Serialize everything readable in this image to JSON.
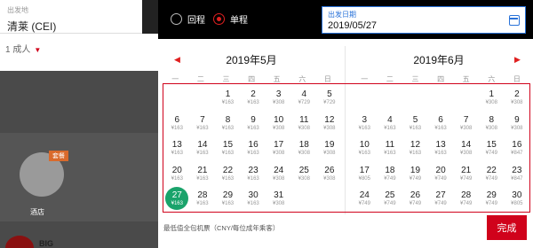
{
  "background": {
    "origin_label": "出发地",
    "origin_value": "清莱 (CEI)",
    "passengers": "1 成人",
    "badge": "套餐",
    "hotel_label": "酒店",
    "logo_text": "BIG"
  },
  "header": {
    "return_label": "回程",
    "oneway_label": "单程",
    "depart_label": "出发日期",
    "depart_value": "2019/05/27"
  },
  "months": [
    {
      "title": "2019年5月",
      "weekdays": [
        "一",
        "二",
        "三",
        "四",
        "五",
        "六",
        "日"
      ],
      "offset": 2,
      "days": [
        {
          "d": "1",
          "p": "¥163"
        },
        {
          "d": "2",
          "p": "¥163"
        },
        {
          "d": "3",
          "p": "¥308"
        },
        {
          "d": "4",
          "p": "¥729"
        },
        {
          "d": "5",
          "p": "¥729"
        },
        {
          "d": "6",
          "p": "¥163"
        },
        {
          "d": "7",
          "p": "¥163"
        },
        {
          "d": "8",
          "p": "¥163"
        },
        {
          "d": "9",
          "p": "¥163"
        },
        {
          "d": "10",
          "p": "¥308"
        },
        {
          "d": "11",
          "p": "¥308"
        },
        {
          "d": "12",
          "p": "¥308"
        },
        {
          "d": "13",
          "p": "¥163"
        },
        {
          "d": "14",
          "p": "¥163"
        },
        {
          "d": "15",
          "p": "¥163"
        },
        {
          "d": "16",
          "p": "¥163"
        },
        {
          "d": "17",
          "p": "¥308"
        },
        {
          "d": "18",
          "p": "¥308"
        },
        {
          "d": "19",
          "p": "¥308"
        },
        {
          "d": "20",
          "p": "¥163"
        },
        {
          "d": "21",
          "p": "¥163"
        },
        {
          "d": "22",
          "p": "¥163"
        },
        {
          "d": "23",
          "p": "¥163"
        },
        {
          "d": "24",
          "p": "¥308"
        },
        {
          "d": "25",
          "p": "¥308"
        },
        {
          "d": "26",
          "p": "¥308"
        },
        {
          "d": "27",
          "p": "¥163",
          "sel": true
        },
        {
          "d": "28",
          "p": "¥163"
        },
        {
          "d": "29",
          "p": "¥163"
        },
        {
          "d": "30",
          "p": "¥163"
        },
        {
          "d": "31",
          "p": "¥308"
        }
      ]
    },
    {
      "title": "2019年6月",
      "weekdays": [
        "一",
        "二",
        "三",
        "四",
        "五",
        "六",
        "日"
      ],
      "offset": 5,
      "days": [
        {
          "d": "1",
          "p": "¥308"
        },
        {
          "d": "2",
          "p": "¥308"
        },
        {
          "d": "3",
          "p": "¥163"
        },
        {
          "d": "4",
          "p": "¥163"
        },
        {
          "d": "5",
          "p": "¥163"
        },
        {
          "d": "6",
          "p": "¥163"
        },
        {
          "d": "7",
          "p": "¥308"
        },
        {
          "d": "8",
          "p": "¥308"
        },
        {
          "d": "9",
          "p": "¥308"
        },
        {
          "d": "10",
          "p": "¥163"
        },
        {
          "d": "11",
          "p": "¥163"
        },
        {
          "d": "12",
          "p": "¥163"
        },
        {
          "d": "13",
          "p": "¥163"
        },
        {
          "d": "14",
          "p": "¥308"
        },
        {
          "d": "15",
          "p": "¥749"
        },
        {
          "d": "16",
          "p": "¥847"
        },
        {
          "d": "17",
          "p": "¥805"
        },
        {
          "d": "18",
          "p": "¥749"
        },
        {
          "d": "19",
          "p": "¥749"
        },
        {
          "d": "20",
          "p": "¥749"
        },
        {
          "d": "21",
          "p": "¥749"
        },
        {
          "d": "22",
          "p": "¥749"
        },
        {
          "d": "23",
          "p": "¥847"
        },
        {
          "d": "24",
          "p": "¥749"
        },
        {
          "d": "25",
          "p": "¥749"
        },
        {
          "d": "26",
          "p": "¥749"
        },
        {
          "d": "27",
          "p": "¥749"
        },
        {
          "d": "28",
          "p": "¥749"
        },
        {
          "d": "29",
          "p": "¥749"
        },
        {
          "d": "30",
          "p": "¥805"
        }
      ]
    }
  ],
  "footer": {
    "note": "最低值全包机票（CNY/每位成年乘客）",
    "done_label": "完成"
  },
  "colors": {
    "accent": "#d0021b",
    "selected": "#1aa36b",
    "focus": "#2a73d9"
  },
  "icons": [
    "radio-icon",
    "calendar-icon",
    "prev-month-icon",
    "next-month-icon",
    "dropdown-caret-icon",
    "hotel-icon"
  ]
}
